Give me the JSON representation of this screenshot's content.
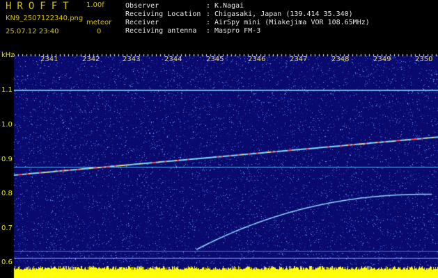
{
  "header": {
    "app_title": "HROFFT",
    "version": "1.00f",
    "filename": "KN9_2507122340.png",
    "meteor_label": "meteor",
    "datetime": "25.07.12 23:40",
    "meteor_count": "0",
    "info": [
      {
        "key": "Observer",
        "value": "K.Nagai"
      },
      {
        "key": "Receiving Location",
        "value": "Chigasaki, Japan (139.414 35.340)"
      },
      {
        "key": "Receiver",
        "value": "AirSpy mini (Miakejima VOR 108.65MHz)"
      },
      {
        "key": "Receiving antenna",
        "value": "Maspro FM-3"
      }
    ],
    "separator": ":"
  },
  "spectrogram": {
    "y_unit": "kHz",
    "y_ticks": [
      "1.1",
      "1.0",
      "0.9",
      "0.8",
      "0.7",
      "0.6"
    ],
    "x_ticks": [
      "2341",
      "2342",
      "2343",
      "2344",
      "2345",
      "2346",
      "2347",
      "2348",
      "2349",
      "2350"
    ],
    "colors": {
      "background": "#0a0a6e",
      "noise": "#2a4fd0",
      "signal": "#7fe0ff",
      "strong_signal": "#ff5050",
      "baseline": "#ffff00",
      "label": "#e8e800"
    }
  }
}
